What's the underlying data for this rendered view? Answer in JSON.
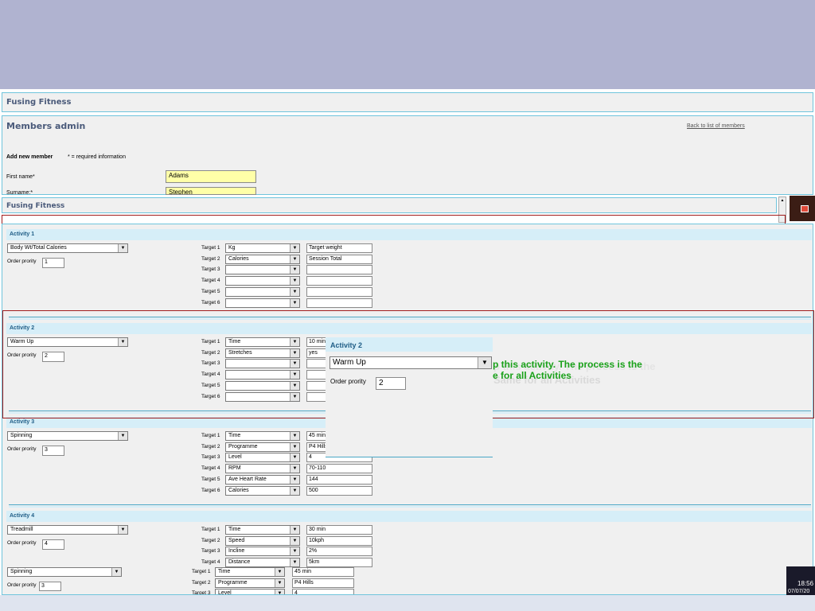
{
  "app": {
    "brand": "Fusing Fitness",
    "page_title": "Members admin",
    "back_link": "Back to list of members"
  },
  "form": {
    "heading": "Add new member",
    "required_note": "* = required information",
    "first_name_label": "First name*",
    "first_name_value": "Adams",
    "surname_label": "Surname:*",
    "surname_value": "Stephen"
  },
  "overlay": {
    "brand": "Fusing Fitness"
  },
  "activities": [
    {
      "title": "Activity 1",
      "activity": "Body Wt/Total Calories",
      "order_label": "Order prority",
      "order": "1",
      "targets": [
        {
          "label": "Target 1",
          "type": "Kg",
          "value": "Target weight"
        },
        {
          "label": "Target 2",
          "type": "Calories",
          "value": "Session Total"
        },
        {
          "label": "Target 3",
          "type": "",
          "value": ""
        },
        {
          "label": "Target 4",
          "type": "",
          "value": ""
        },
        {
          "label": "Target 5",
          "type": "",
          "value": ""
        },
        {
          "label": "Target 6",
          "type": "",
          "value": ""
        }
      ]
    },
    {
      "title": "Activity 2",
      "activity": "Warm Up",
      "order_label": "Order prority",
      "order": "2",
      "targets": [
        {
          "label": "Target 1",
          "type": "Time",
          "value": "10 min"
        },
        {
          "label": "Target 2",
          "type": "Stretches",
          "value": "yes"
        },
        {
          "label": "Target 3",
          "type": "",
          "value": ""
        },
        {
          "label": "Target 4",
          "type": "",
          "value": ""
        },
        {
          "label": "Target 5",
          "type": "",
          "value": ""
        },
        {
          "label": "Target 6",
          "type": "",
          "value": ""
        }
      ]
    },
    {
      "title": "Activity 3",
      "activity": "Spinning",
      "order_label": "Order prority",
      "order": "3",
      "targets": [
        {
          "label": "Target 1",
          "type": "Time",
          "value": "45 min"
        },
        {
          "label": "Target 2",
          "type": "Programme",
          "value": "P4 Hills"
        },
        {
          "label": "Target 3",
          "type": "Level",
          "value": "4"
        },
        {
          "label": "Target 4",
          "type": "RPM",
          "value": "70-110"
        },
        {
          "label": "Target 5",
          "type": "Ave Heart Rate",
          "value": "144"
        },
        {
          "label": "Target 6",
          "type": "Calories",
          "value": "500"
        }
      ]
    },
    {
      "title": "Activity 4",
      "activity": "Treadmill",
      "order_label": "Order prority",
      "order": "4",
      "targets": [
        {
          "label": "Target 1",
          "type": "Time",
          "value": "30 min"
        },
        {
          "label": "Target 2",
          "type": "Speed",
          "value": "10kph"
        },
        {
          "label": "Target 3",
          "type": "Incline",
          "value": "2%"
        },
        {
          "label": "Target 4",
          "type": "Distance",
          "value": "5km"
        }
      ]
    }
  ],
  "extra_row": {
    "activity": "Spinning",
    "order_label": "Order prority",
    "order": "3",
    "targets": [
      {
        "label": "Target 1",
        "type": "Time",
        "value": "45 min"
      },
      {
        "label": "Target 2",
        "type": "Programme",
        "value": "P4 Hills"
      },
      {
        "label": "Target 3",
        "type": "Level",
        "value": "4"
      }
    ]
  },
  "zoom": {
    "title": "Activity 2",
    "activity": "Warm Up",
    "order_label": "Order prority",
    "order": "2"
  },
  "callout": {
    "line1": "p this activity. The process is the",
    "line2": "e for all Activities",
    "ghost1": "p this activity. The process is the",
    "ghost2": "Same for all Activities"
  },
  "taskbar": {
    "time": "18:56",
    "date": "07/07/20"
  },
  "colors": {
    "accent": "#1f5d86",
    "callout": "#1aa11a",
    "highlight": "#a11c1c",
    "required_field": "#ffffa8"
  }
}
